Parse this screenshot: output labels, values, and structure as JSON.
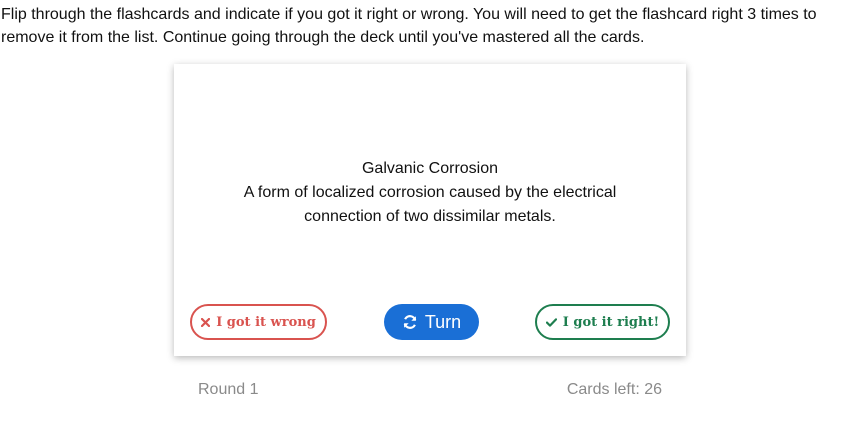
{
  "instructions": "Flip through the flashcards and indicate if you got it right or wrong. You will need to get the flashcard right 3 times to remove it from the list. Continue going through the deck until you've mastered all the cards.",
  "card": {
    "term": "Galvanic Corrosion",
    "definition": "A form of localized corrosion caused by the electrical connection of two dissimilar metals."
  },
  "buttons": {
    "wrong_label": "I got it wrong",
    "wrong_icon": "x-icon",
    "turn_label": "Turn",
    "turn_icon": "refresh-icon",
    "right_label": "I got it right!",
    "right_icon": "check-icon"
  },
  "footer": {
    "round": "Round 1",
    "cards_left": "Cards left: 26"
  },
  "colors": {
    "wrong": "#d9534f",
    "right": "#1e7e4f",
    "turn": "#1a6fd6",
    "muted": "#8a8a8a"
  }
}
